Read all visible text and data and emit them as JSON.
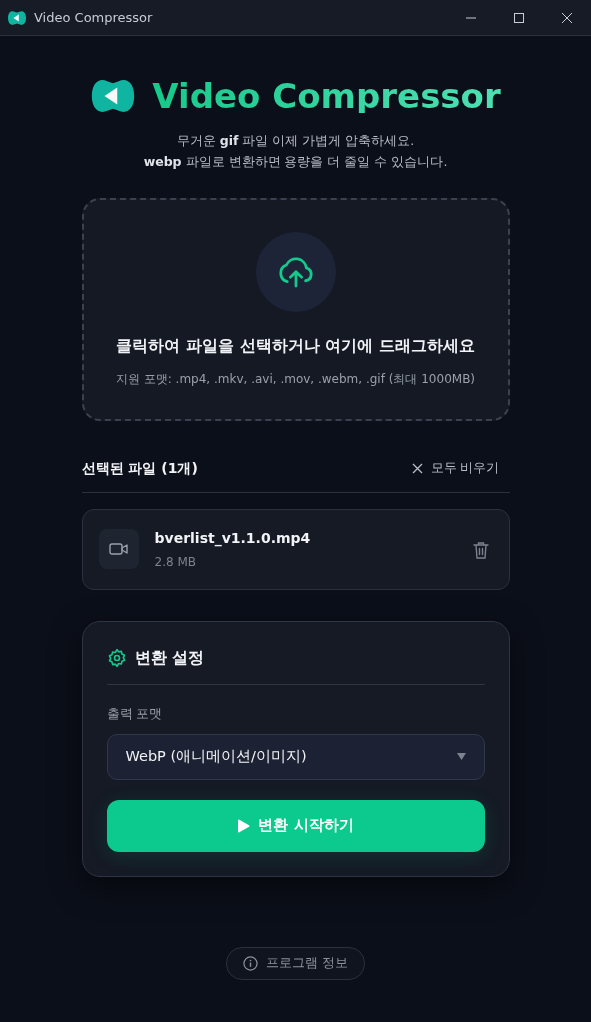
{
  "window": {
    "title": "Video Compressor"
  },
  "header": {
    "title": "Video Compressor",
    "subtitle_lines": [
      "무거운 **gif** 파일 이제 가볍게 압축하세요.",
      "**webp** 파일로 변환하면 용량을 더 줄일 수 있습니다."
    ]
  },
  "dropzone": {
    "title": "클릭하여 파일을 선택하거나 여기에 드래그하세요",
    "hint": "지원 포맷: .mp4, .mkv, .avi, .mov, .webm, .gif (최대 1000MB)"
  },
  "files": {
    "heading": "선택된 파일 (1개)",
    "clear_label": "모두 비우기",
    "items": [
      {
        "name": "bverlist_v1.1.0.mp4",
        "size": "2.8 MB"
      }
    ]
  },
  "settings": {
    "title": "변환 설정",
    "format_label": "출력 포맷",
    "format_value": "WebP (애니메이션/이미지)",
    "start_label": "변환 시작하기"
  },
  "footer": {
    "about_label": "프로그램 정보"
  }
}
